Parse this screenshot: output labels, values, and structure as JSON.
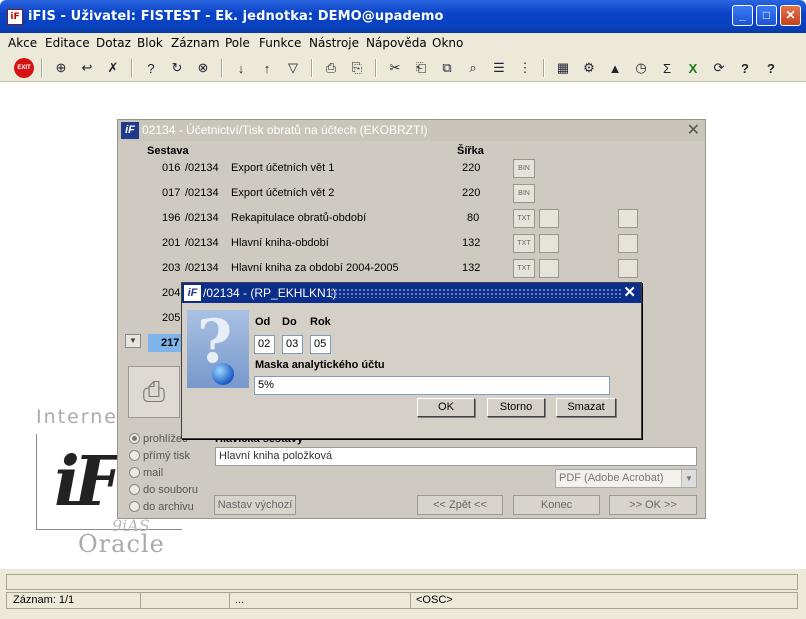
{
  "window": {
    "title": "iFIS - Uživatel: FISTEST - Ek. jednotka: DEMO@upademo",
    "app_icon": "iFIS-app-icon",
    "buttons": [
      "_",
      "□",
      "✕"
    ]
  },
  "menubar": {
    "items": [
      "Akce",
      "Editace",
      "Dotaz",
      "Blok",
      "Záznam",
      "Pole",
      "Funkce",
      "Nástroje",
      "Nápověda",
      "Okno"
    ]
  },
  "toolbar": {
    "exit_label": "EXIT",
    "icons": [
      "exit-icon",
      "insert-record-icon",
      "save-icon",
      "delete-record-icon",
      "query-icon",
      "execute-query-icon",
      "cancel-query-icon",
      "sort-ascending-icon",
      "sort-descending-icon",
      "filter-icon",
      "print-icon",
      "print-setup-icon",
      "cut-icon",
      "copy-icon",
      "paste-icon",
      "find-icon",
      "list-icon",
      "columns-icon",
      "calculator-icon",
      "settings-icon",
      "map-icon",
      "clock-icon",
      "sum-icon",
      "excel-icon",
      "refresh-icon",
      "help-icon",
      "context-help-icon"
    ],
    "glyphs": [
      "EXIT",
      "⊕",
      "↩",
      "✗",
      "?",
      "↻",
      "⊗",
      "↓",
      "↑",
      "▽",
      "⎙",
      "⎘",
      "✂",
      "⎗",
      "⧉",
      "⌕",
      "☰",
      "⋮",
      "▦",
      "⚙",
      "▲",
      "◷",
      "Σ",
      "X",
      "⟳",
      "?",
      "?"
    ]
  },
  "logo": {
    "internet": "Internet",
    "if": "iF",
    "ias": "9iAS",
    "oracle": "Oracle"
  },
  "bgform": {
    "title": "02134 - Účetnictví/Tisk obratů na účtech (EKOBRZTI)",
    "icon_label": "iF",
    "close": "✕",
    "col_sestava": "Sestava",
    "col_sirka": "Šířka",
    "rows": [
      {
        "num": "016",
        "code": "/02134",
        "name": "Export účetních vět 1",
        "width": "220"
      },
      {
        "num": "017",
        "code": "/02134",
        "name": "Export účetních vět 2",
        "width": "220"
      },
      {
        "num": "196",
        "code": "/02134",
        "name": "Rekapitulace obratů-období",
        "width": "80"
      },
      {
        "num": "201",
        "code": "/02134",
        "name": "Hlavní kniha-období",
        "width": "132"
      },
      {
        "num": "203",
        "code": "/02134",
        "name": "Hlavní kniha za období 2004-2005",
        "width": "132"
      },
      {
        "num": "204",
        "code": "",
        "name": "",
        "width": ""
      },
      {
        "num": "205",
        "code": "",
        "name": "",
        "width": ""
      }
    ],
    "selected_row": "217",
    "icon_text_bin": "BIN",
    "icon_text_txt": "TXT",
    "radio_options": [
      "prohlížeč",
      "přímý tisk",
      "mail",
      "do souboru",
      "do archivu"
    ],
    "radio_selected": 0,
    "nazev_label": "Hlavička sestavy",
    "nazev_value": "Hlavní kniha položková",
    "format_value": "PDF (Adobe Acrobat)",
    "buttons": {
      "nastav": "Nastav výchozí",
      "zpet": "<< Zpět <<",
      "konec": "Konec",
      "ok": ">> OK >>"
    }
  },
  "dialog": {
    "title": "/02134 - (RP_EKHLKN1)",
    "icon_label": "iF",
    "close": "✕",
    "od_label": "Od",
    "do_label": "Do",
    "rok_label": "Rok",
    "od_value": "02",
    "do_value": "03",
    "rok_value": "05",
    "maska_label": "Maska analytického účtu",
    "maska_value": "5%",
    "ok": "OK",
    "storno": "Storno",
    "smazat": "Smazat"
  },
  "statusbar": {
    "zaznam": "Záznam: 1/1",
    "dots": "...",
    "osc": "<OSC>"
  }
}
